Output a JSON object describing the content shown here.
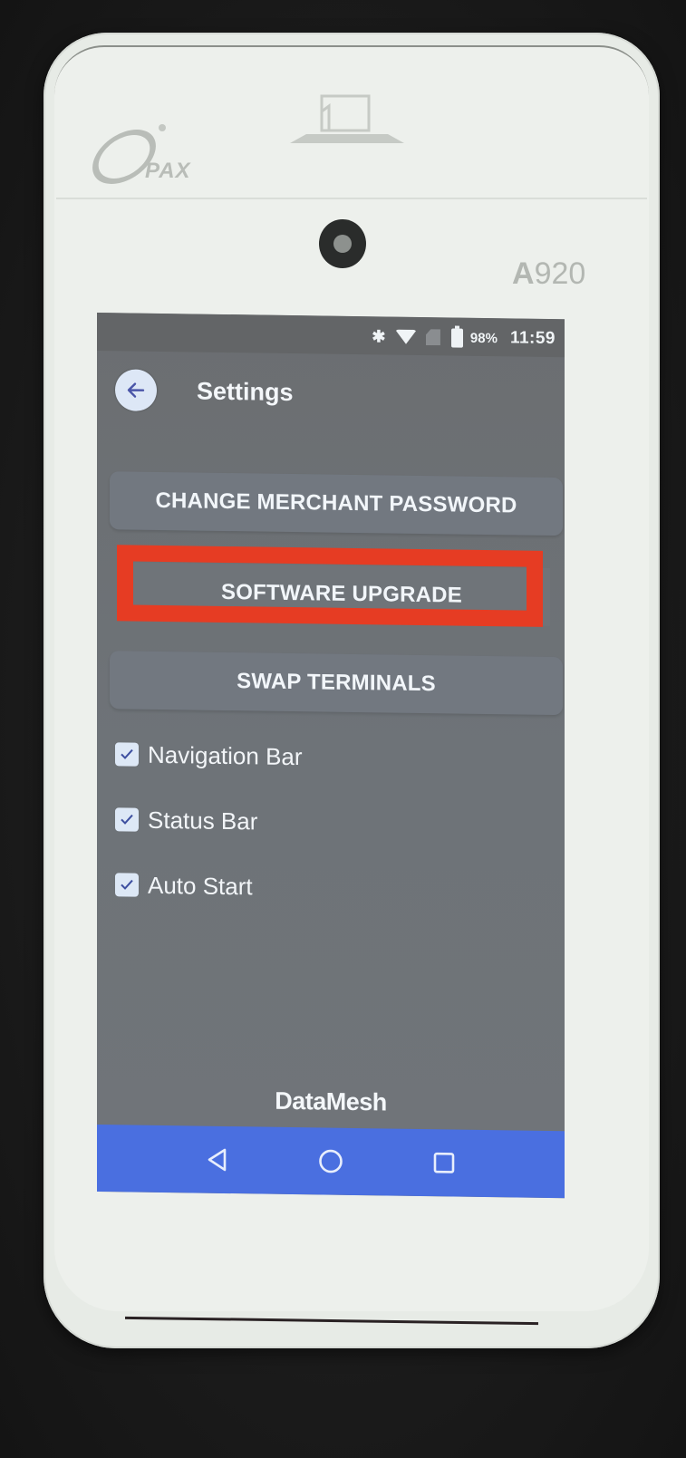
{
  "device": {
    "brand_logo_text": "PAX",
    "model_label_bold": "A",
    "model_label_rest": "920"
  },
  "status_bar": {
    "icons": [
      "bluetooth-icon",
      "wifi-icon",
      "no-sim-icon",
      "battery-icon"
    ],
    "battery_percent": "98%",
    "time": "11:59"
  },
  "header": {
    "back_icon": "arrow-left-icon",
    "title": "Settings"
  },
  "menu": {
    "buttons": [
      {
        "label": "CHANGE MERCHANT PASSWORD"
      },
      {
        "label": "SOFTWARE UPGRADE",
        "highlighted": true
      },
      {
        "label": "SWAP TERMINALS"
      }
    ]
  },
  "options": [
    {
      "label": "Navigation Bar",
      "checked": true
    },
    {
      "label": "Status Bar",
      "checked": true
    },
    {
      "label": "Auto Start",
      "checked": true
    }
  ],
  "footer": {
    "brand": "DataMesh"
  },
  "nav_bar": {
    "items": [
      "back-icon",
      "home-icon",
      "recents-icon"
    ]
  },
  "colors": {
    "highlight": "#e63c23",
    "nav_bar": "#4a6fe0",
    "screen_bg": "#6e7378",
    "button_bg": "#727880",
    "checkbox": "#dde8f6"
  }
}
